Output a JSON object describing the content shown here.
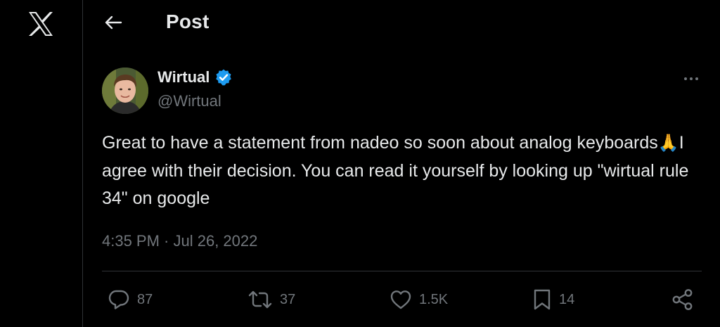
{
  "app": {
    "logo_icon": "x-logo-icon"
  },
  "header": {
    "title": "Post",
    "back_icon": "arrow-left-icon"
  },
  "author": {
    "display_name": "Wirtual",
    "handle": "@Wirtual",
    "verified": true,
    "verified_color": "#1d9bf0"
  },
  "tweet": {
    "text_part1": "Great to have a statement from nadeo so soon about analog keyboards",
    "emoji": "🙏",
    "text_part2": "I agree with their decision. You can read it yourself by looking up \"wirtual rule 34\" on google",
    "timestamp": "4:35 PM · Jul 26, 2022"
  },
  "actions": {
    "reply_count": "87",
    "retweet_count": "37",
    "like_count": "1.5K",
    "bookmark_count": "14"
  },
  "colors": {
    "background": "#000000",
    "text": "#e7e9ea",
    "muted": "#71767b",
    "border": "#2f3336"
  }
}
